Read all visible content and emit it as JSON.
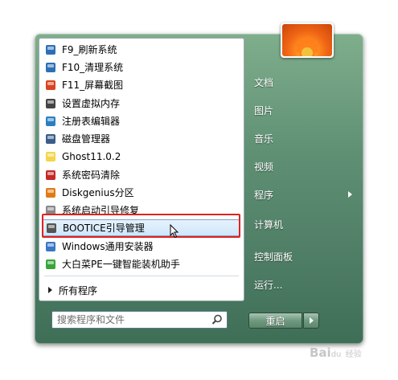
{
  "programs": [
    {
      "label": "F9_刷新系统",
      "icon": "refresh-app-icon",
      "color": "#2d6fb5"
    },
    {
      "label": "F10_清理系统",
      "icon": "cleanup-app-icon",
      "color": "#2d6fb5"
    },
    {
      "label": "F11_屏幕截图",
      "icon": "screenshot-app-icon",
      "color": "#d8441e"
    },
    {
      "label": "设置虚拟内存",
      "icon": "memory-chip-icon",
      "color": "#444444"
    },
    {
      "label": "注册表编辑器",
      "icon": "registry-icon",
      "color": "#2a7fc1"
    },
    {
      "label": "磁盘管理器",
      "icon": "disk-manager-icon",
      "color": "#3b5d8a"
    },
    {
      "label": "Ghost11.0.2",
      "icon": "ghost-icon",
      "color": "#f5d44a"
    },
    {
      "label": "系统密码清除",
      "icon": "password-clear-icon",
      "color": "#c62828"
    },
    {
      "label": "Diskgenius分区",
      "icon": "diskgenius-icon",
      "color": "#e07a16"
    },
    {
      "label": "系统启动引导修复",
      "icon": "boot-repair-icon",
      "color": "#888888"
    },
    {
      "label": "BOOTICE引导管理",
      "icon": "bootice-icon",
      "color": "#555555",
      "selected": true
    },
    {
      "label": "Windows通用安装器",
      "icon": "windows-installer-icon",
      "color": "#3a77c4"
    },
    {
      "label": "大白菜PE一键智能装机助手",
      "icon": "cabbage-installer-icon",
      "color": "#3aa43a"
    }
  ],
  "all_programs": "所有程序",
  "search": {
    "placeholder": "搜索程序和文件"
  },
  "right_items": [
    {
      "label": "文档",
      "arrow": false
    },
    {
      "label": "图片",
      "arrow": false
    },
    {
      "label": "音乐",
      "arrow": false
    },
    {
      "label": "视频",
      "arrow": false
    },
    {
      "label": "程序",
      "arrow": true
    },
    {
      "label": "计算机",
      "arrow": false
    },
    {
      "label": "控制面板",
      "arrow": false
    },
    {
      "label": "运行...",
      "arrow": false
    }
  ],
  "power": {
    "label": "重启"
  },
  "watermark": {
    "brand": "Bai",
    "suffix": "du",
    "sub": "经验"
  }
}
